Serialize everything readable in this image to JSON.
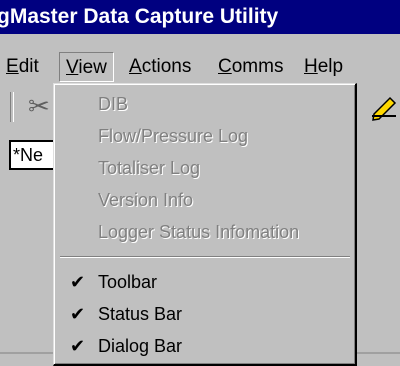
{
  "window": {
    "title": "gMaster Data Capture Utility"
  },
  "menubar": {
    "items": [
      {
        "label": "Edit"
      },
      {
        "label": "View"
      },
      {
        "label": "Actions"
      },
      {
        "label": "Comms"
      },
      {
        "label": "Help"
      }
    ]
  },
  "toolbar": {
    "icons": [
      "scissors-icon",
      "pencil-icon"
    ]
  },
  "dialogbar": {
    "input_value": "*Ne"
  },
  "view_menu": {
    "items": [
      {
        "label": "DIB",
        "enabled": false,
        "checked": false
      },
      {
        "label": "Flow/Pressure Log",
        "enabled": false,
        "checked": false
      },
      {
        "label": "Totaliser Log",
        "enabled": false,
        "checked": false
      },
      {
        "label": "Version Info",
        "enabled": false,
        "checked": false
      },
      {
        "label": "Logger Status Infomation",
        "enabled": false,
        "checked": false
      },
      {
        "label": "Toolbar",
        "enabled": true,
        "checked": true
      },
      {
        "label": "Status Bar",
        "enabled": true,
        "checked": true
      },
      {
        "label": "Dialog Bar",
        "enabled": true,
        "checked": true
      }
    ],
    "check_glyph": "✔"
  }
}
